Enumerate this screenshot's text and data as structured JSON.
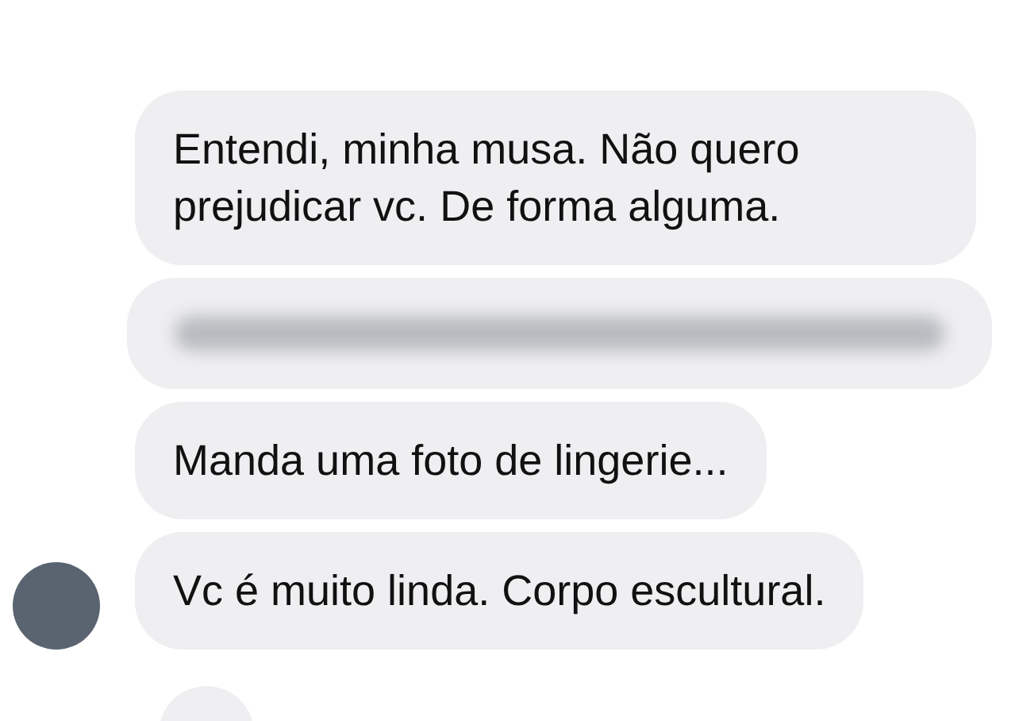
{
  "messages": [
    {
      "kind": "text",
      "text": "Entendi, minha musa. Não quero prejudicar vc. De forma alguma.",
      "show_avatar": false
    },
    {
      "kind": "blurred",
      "show_avatar": false
    },
    {
      "kind": "text",
      "text": "Manda uma foto de lingerie...",
      "show_avatar": false
    },
    {
      "kind": "text",
      "text": "Vc é muito linda. Corpo escultural.",
      "show_avatar": true
    },
    {
      "kind": "partial",
      "show_avatar": false
    }
  ]
}
